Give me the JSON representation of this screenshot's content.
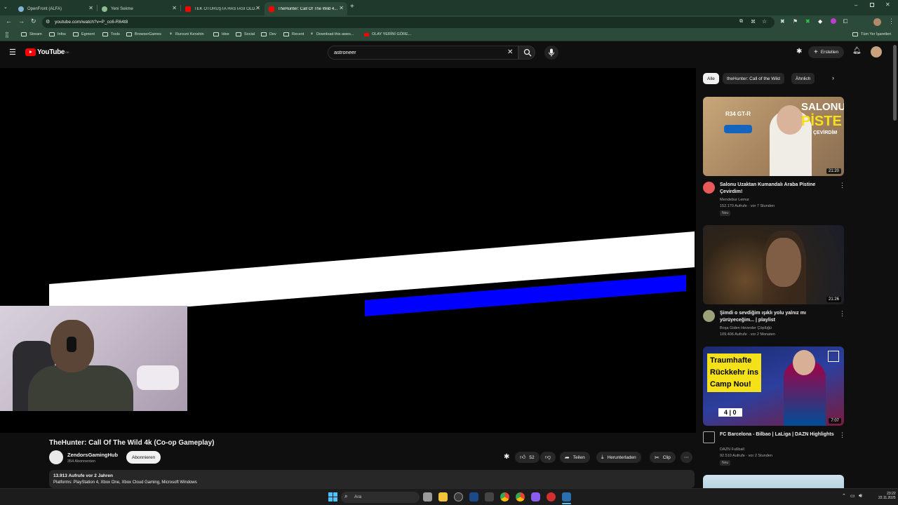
{
  "browser": {
    "tabs": [
      {
        "title": "OpenFront (ALFA)",
        "favicon_color": "#7fb3d5",
        "active": false
      },
      {
        "title": "Yeni Sekme",
        "favicon_color": "#8fbc8f",
        "active": false
      },
      {
        "title": "TEK OTURUŞTA HASTASI OLD...",
        "favicon_color": "#ff0000",
        "active": false
      },
      {
        "title": "TheHunter: Call Of The Wild 4...",
        "favicon_color": "#ff0000",
        "active": true
      }
    ],
    "new_tab_label": "+",
    "url": "youtube.com/watch?v=P_cc6-R64t8",
    "bookmarks": [
      {
        "label": "Stream",
        "icon": "folder-icon"
      },
      {
        "label": "Infos",
        "icon": "folder-icon"
      },
      {
        "label": "Egment",
        "icon": "folder-icon"
      },
      {
        "label": "Tools",
        "icon": "folder-icon"
      },
      {
        "label": "BrowserGames",
        "icon": "folder-icon"
      },
      {
        "label": "Rurouni Kenshin",
        "icon": "bookmark-icon"
      },
      {
        "label": "Idee",
        "icon": "folder-icon"
      },
      {
        "label": "Social",
        "icon": "folder-icon"
      },
      {
        "label": "Dev",
        "icon": "folder-icon"
      },
      {
        "label": "Recent",
        "icon": "folder-icon"
      },
      {
        "label": "Download this awes...",
        "icon": "bookmark-icon"
      },
      {
        "label": "OLAY YERİNİ GÖRE...",
        "icon": "youtube-icon"
      }
    ],
    "all_bookmarks_label": "Tüm Yer İşaretleri"
  },
  "youtube": {
    "logo_text": "YouTube",
    "logo_region": "DE",
    "search_value": "astroneer",
    "create_label": "Erstellen",
    "chips": [
      {
        "label": "Alle",
        "active": true
      },
      {
        "label": "theHunter: Call of the Wild",
        "active": false
      },
      {
        "label": "Ähnlich",
        "active": false
      }
    ],
    "video": {
      "title": "TheHunter: Call Of The Wild 4k (Co-op Gameplay)",
      "channel": "ZendorsGamingHub",
      "subscribers": "354 Abonnenten",
      "subscribe_label": "Abonnieren",
      "likes": "52",
      "share_label": "Teilen",
      "download_label": "Herunterladen",
      "clip_label": "Clip",
      "views_date": "13.913 Aufrufe  vor 2 Jahren",
      "description": "Platforms: PlayStation 4, Xbox One, Xbox Cloud Gaming, Microsoft Windows"
    },
    "recommendations": [
      {
        "title": "Salonu Uzaktan Kumandalı Araba Pistine Çevirdim!",
        "channel": "Mendebur Lemur",
        "meta": "152.170 Aufrufe · vor 7 Stunden",
        "badge": "Neu",
        "duration": "21:20",
        "thumb_text": [
          "SALONU",
          "PİSTE",
          "ÇEVİRDİM"
        ],
        "thumb_tag": "R34 GT-R"
      },
      {
        "title": "Şimdi o sevdiğim ışıklı yolu yalnız mı yürüyeceğim... | playlist",
        "channel": "Boşa Giden Hevesler Çöplüğü",
        "meta": "109.406 Aufrufe · vor 2 Monaten",
        "badge": "",
        "duration": "21:26"
      },
      {
        "title": "FC Barcelona - Bilbao | LaLiga | DAZN Highlights",
        "channel": "DAZN Fußball",
        "meta": "92.510 Aufrufe · vor 2 Stunden",
        "badge": "Neu",
        "duration": "7:07",
        "thumb_text": [
          "Traumhafte",
          "Rückkehr ins",
          "Camp Nou!"
        ],
        "score": "4 | 0"
      }
    ]
  },
  "taskbar": {
    "search_placeholder": "Ara",
    "time": "23:22",
    "date": "22.11.2025"
  },
  "colors": {
    "browser_frame": "#1f3a2c",
    "yt_red": "#ff0000",
    "video_stripe_white": "#ffffff",
    "video_stripe_blue": "#0000ff"
  }
}
